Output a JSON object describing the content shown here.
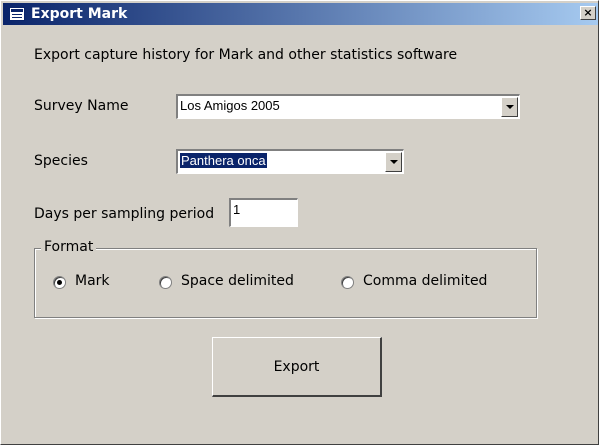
{
  "window": {
    "title": "Export Mark",
    "close_label": "×"
  },
  "form": {
    "description": "Export capture history for Mark and other statistics software",
    "survey_label": "Survey Name",
    "survey_value": "Los Amigos 2005",
    "species_label": "Species",
    "species_value": "Panthera onca",
    "days_label": "Days per sampling period",
    "days_value": "1"
  },
  "format": {
    "legend": "Format",
    "options": [
      {
        "label": "Mark",
        "checked": true
      },
      {
        "label": "Space delimited",
        "checked": false
      },
      {
        "label": "Comma delimited",
        "checked": false
      }
    ]
  },
  "actions": {
    "export_label": "Export"
  },
  "colors": {
    "titlebar_start": "#0a246a",
    "titlebar_end": "#a6caf0",
    "face": "#d4d0c8",
    "selection": "#0a246a"
  },
  "icons": {
    "title": "form-icon",
    "close": "close-icon",
    "dropdown": "chevron-down-icon"
  }
}
